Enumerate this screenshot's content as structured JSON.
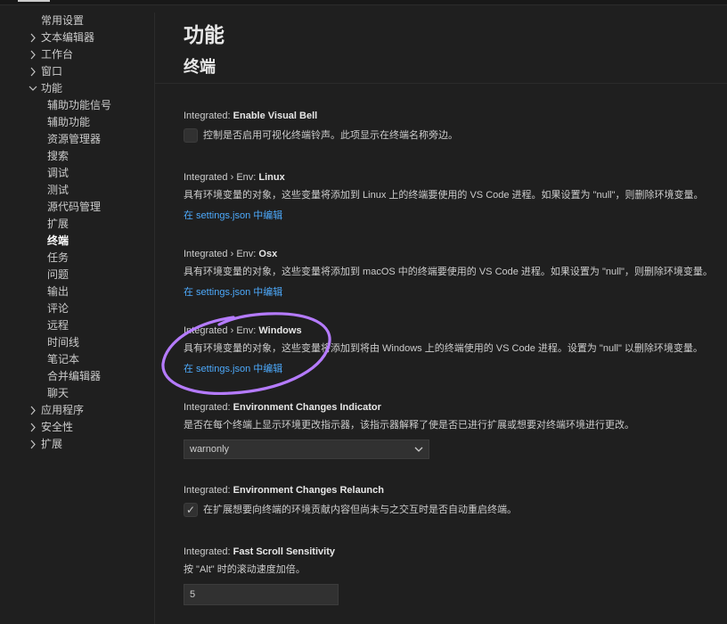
{
  "sidebar": {
    "items": [
      {
        "label": "常用设置",
        "chevron": "",
        "indent": 0
      },
      {
        "label": "文本编辑器",
        "chevron": "›",
        "indent": 0
      },
      {
        "label": "工作台",
        "chevron": "›",
        "indent": 0
      },
      {
        "label": "窗口",
        "chevron": "›",
        "indent": 0
      },
      {
        "label": "功能",
        "chevron": "⌄",
        "indent": 0
      },
      {
        "label": "辅助功能信号",
        "chevron": "",
        "indent": 1
      },
      {
        "label": "辅助功能",
        "chevron": "",
        "indent": 1
      },
      {
        "label": "资源管理器",
        "chevron": "",
        "indent": 1
      },
      {
        "label": "搜索",
        "chevron": "",
        "indent": 1
      },
      {
        "label": "调试",
        "chevron": "",
        "indent": 1
      },
      {
        "label": "测试",
        "chevron": "",
        "indent": 1
      },
      {
        "label": "源代码管理",
        "chevron": "",
        "indent": 1
      },
      {
        "label": "扩展",
        "chevron": "",
        "indent": 1
      },
      {
        "label": "终端",
        "chevron": "",
        "indent": 1,
        "selected": true
      },
      {
        "label": "任务",
        "chevron": "",
        "indent": 1
      },
      {
        "label": "问题",
        "chevron": "",
        "indent": 1
      },
      {
        "label": "输出",
        "chevron": "",
        "indent": 1
      },
      {
        "label": "评论",
        "chevron": "",
        "indent": 1
      },
      {
        "label": "远程",
        "chevron": "",
        "indent": 1
      },
      {
        "label": "时间线",
        "chevron": "",
        "indent": 1
      },
      {
        "label": "笔记本",
        "chevron": "",
        "indent": 1
      },
      {
        "label": "合并编辑器",
        "chevron": "",
        "indent": 1
      },
      {
        "label": "聊天",
        "chevron": "",
        "indent": 1
      },
      {
        "label": "应用程序",
        "chevron": "›",
        "indent": 0
      },
      {
        "label": "安全性",
        "chevron": "›",
        "indent": 0
      },
      {
        "label": "扩展",
        "chevron": "›",
        "indent": 0
      }
    ]
  },
  "main": {
    "heading": "功能",
    "subheading": "终端",
    "settings": {
      "visual_bell": {
        "prefix": "Integrated: ",
        "name": "Enable Visual Bell",
        "description": "控制是否启用可视化终端铃声。此项显示在终端名称旁边。",
        "checked": false
      },
      "env_linux": {
        "prefix": "Integrated › Env: ",
        "name": "Linux",
        "description": "具有环境变量的对象，这些变量将添加到 Linux 上的终端要使用的 VS Code 进程。如果设置为 \"null\"，则删除环境变量。",
        "link": "在 settings.json 中编辑"
      },
      "env_osx": {
        "prefix": "Integrated › Env: ",
        "name": "Osx",
        "description": "具有环境变量的对象，这些变量将添加到 macOS 中的终端要使用的 VS Code 进程。如果设置为 \"null\"，则删除环境变量。",
        "link": "在 settings.json 中编辑"
      },
      "env_windows": {
        "prefix": "Integrated › Env: ",
        "name": "Windows",
        "description": "具有环境变量的对象，这些变量将添加到将由 Windows 上的终端使用的 VS Code 进程。设置为 \"null\" 以删除环境变量。",
        "link": "在 settings.json 中编辑"
      },
      "changes_indicator": {
        "prefix": "Integrated: ",
        "name": "Environment Changes Indicator",
        "description": "是否在每个终端上显示环境更改指示器，该指示器解释了使是否已进行扩展或想要对终端环境进行更改。",
        "value": "warnonly"
      },
      "changes_relaunch": {
        "prefix": "Integrated: ",
        "name": "Environment Changes Relaunch",
        "description": "在扩展想要向终端的环境贡献内容但尚未与之交互时是否自动重启终端。",
        "checked": true
      },
      "fast_scroll": {
        "prefix": "Integrated: ",
        "name": "Fast Scroll Sensitivity",
        "description": "按 \"Alt\" 时的滚动速度加倍。",
        "value": "5"
      }
    }
  },
  "colors": {
    "background": "#1f1f1f",
    "link": "#4daafc",
    "annotation": "#b57bff"
  }
}
